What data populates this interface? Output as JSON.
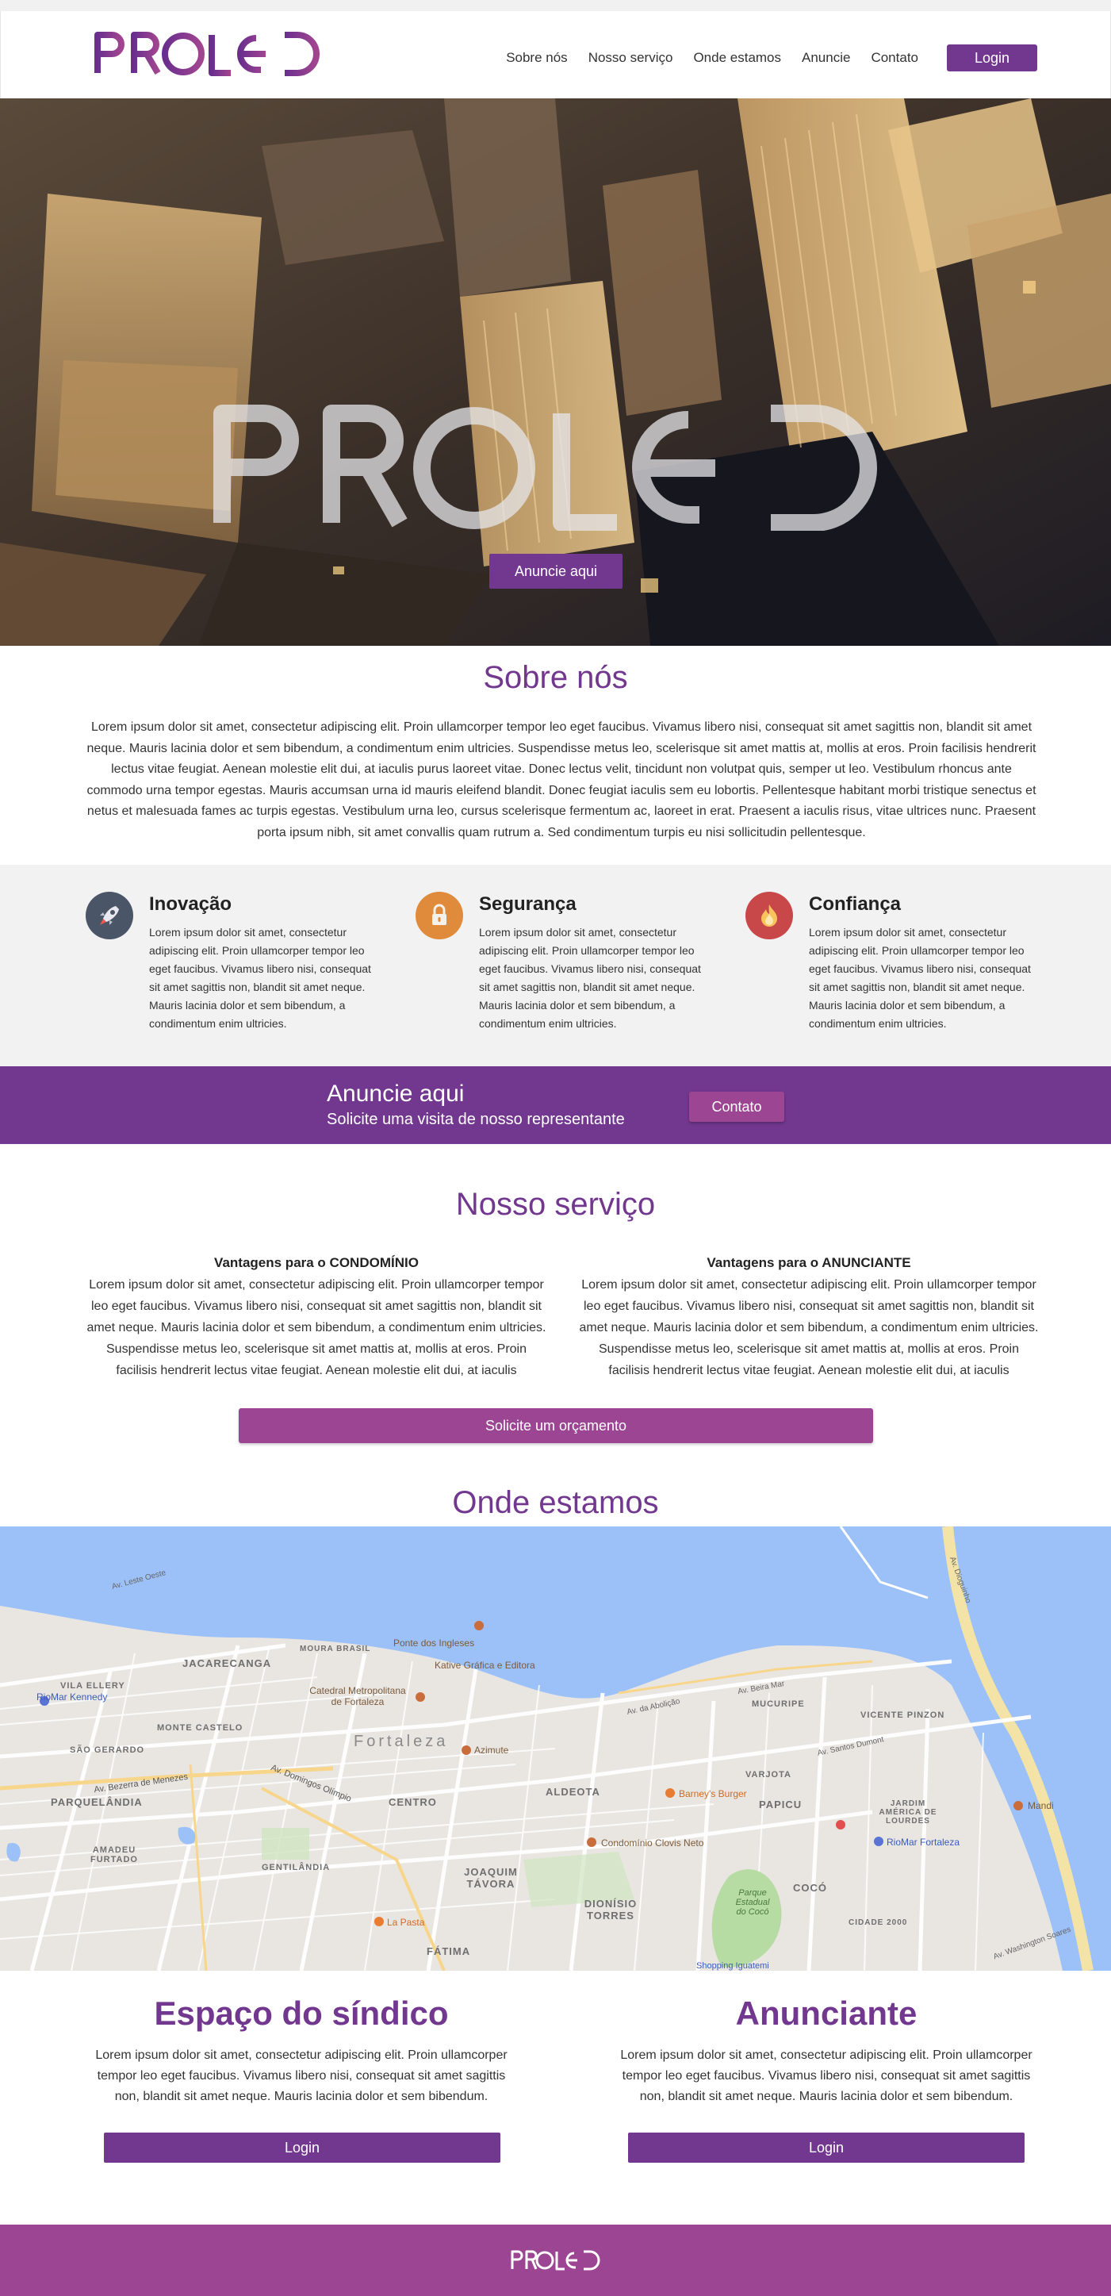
{
  "nav": {
    "brand": "PROLED",
    "links": [
      "Sobre nós",
      "Nosso serviço",
      "Onde estamos",
      "Anuncie",
      "Contato"
    ],
    "login": "Login"
  },
  "hero": {
    "button": "Anuncie aqui"
  },
  "about": {
    "title": "Sobre nós",
    "text": "Lorem ipsum dolor sit amet, consectetur adipiscing elit. Proin ullamcorper tempor leo eget faucibus. Vivamus libero nisi, consequat sit amet sagittis non, blandit sit amet neque. Mauris lacinia dolor et sem bibendum, a condimentum enim ultricies. Suspendisse metus leo, scelerisque sit amet mattis at, mollis at eros. Proin facilisis hendrerit lectus vitae feugiat. Aenean molestie elit dui, at iaculis purus laoreet vitae. Donec lectus velit, tincidunt non volutpat quis, semper ut leo. Vestibulum rhoncus ante commodo urna tempor egestas. Mauris accumsan urna id mauris eleifend blandit. Donec feugiat iaculis sem eu lobortis. Pellentesque habitant morbi tristique senectus et netus et malesuada fames ac turpis egestas. Vestibulum urna leo, cursus scelerisque fermentum ac, laoreet in erat. Praesent a iaculis risus, vitae ultrices nunc. Praesent porta ipsum nibh, sit amet convallis quam rutrum a. Sed condimentum turpis eu nisi sollicitudin pellentesque."
  },
  "features": [
    {
      "title": "Inovação",
      "icon": "rocket-icon",
      "color": "#4a5568",
      "text": "Lorem ipsum dolor sit amet, consectetur adipiscing elit. Proin ullamcorper tempor leo eget faucibus. Vivamus libero nisi, consequat sit amet sagittis non, blandit sit amet neque. Mauris lacinia dolor et sem bibendum, a condimentum enim ultricies."
    },
    {
      "title": "Segurança",
      "icon": "lock-icon",
      "color": "#e08a3c",
      "text": "Lorem ipsum dolor sit amet, consectetur adipiscing elit. Proin ullamcorper tempor leo eget faucibus. Vivamus libero nisi, consequat sit amet sagittis non, blandit sit amet neque. Mauris lacinia dolor et sem bibendum, a condimentum enim ultricies."
    },
    {
      "title": "Confiança",
      "icon": "flame-icon",
      "color": "#c8484a",
      "text": "Lorem ipsum dolor sit amet, consectetur adipiscing elit. Proin ullamcorper tempor leo eget faucibus. Vivamus libero nisi, consequat sit amet sagittis non, blandit sit amet neque. Mauris lacinia dolor et sem bibendum, a condimentum enim ultricies."
    }
  ],
  "cta": {
    "title": "Anuncie aqui",
    "subtitle": "Solicite uma visita de nosso representante",
    "button": "Contato"
  },
  "service": {
    "title": "Nosso serviço",
    "columns": [
      {
        "heading": "Vantagens para o CONDOMÍNIO",
        "text": "Lorem ipsum dolor sit amet, consectetur adipiscing elit. Proin ullamcorper tempor leo eget faucibus. Vivamus libero nisi, consequat sit amet sagittis non, blandit sit amet neque. Mauris lacinia dolor et sem bibendum, a condimentum enim ultricies. Suspendisse metus leo, scelerisque sit amet mattis at, mollis at eros. Proin facilisis hendrerit lectus vitae feugiat. Aenean molestie elit dui, at iaculis"
      },
      {
        "heading": "Vantagens para o ANUNCIANTE",
        "text": "Lorem ipsum dolor sit amet, consectetur adipiscing elit. Proin ullamcorper tempor leo eget faucibus. Vivamus libero nisi, consequat sit amet sagittis non, blandit sit amet neque. Mauris lacinia dolor et sem bibendum, a condimentum enim ultricies. Suspendisse metus leo, scelerisque sit amet mattis at, mollis at eros. Proin facilisis hendrerit lectus vitae feugiat. Aenean molestie elit dui, at iaculis"
      }
    ],
    "button": "Solicite um orçamento"
  },
  "location": {
    "title": "Onde estamos",
    "map_labels": {
      "fortaleza": "Fortaleza",
      "jacarecanga": "JACARECANGA",
      "vila_ellery": "VILA ELLERY",
      "riomar_kennedy": "RioMar Kennedy",
      "monte_castelo": "MONTE CASTELO",
      "sao_gerardo": "SÃO GERARDO",
      "parquelandia": "PARQUELÂNDIA",
      "amadeu_furtado": "AMADEU FURTADO",
      "gentilandia": "GENTILÂNDIA",
      "centro": "CENTRO",
      "joaquim_tavora": "JOAQUIM TÁVORA",
      "dionisio_torres": "DIONÍSIO TORRES",
      "aldeota": "ALDEOTA",
      "papicu": "PAPICU",
      "coco": "COCÓ",
      "varjota": "VARJOTA",
      "mucuripe": "MUCURIPE",
      "vicente_pinzon": "VICENTE PINZON",
      "jardim_america": "JARDIM AMÉRICA DE LOURDES",
      "cidade_2000": "CIDADE 2000",
      "fatima": "FÁTIMA",
      "moura_brasil": "MOURA BRASIL",
      "ponte_ingleses": "Ponte dos Ingleses",
      "kative": "Kative Gráfica e Editora",
      "catedral": "Catedral Metropolitana de Fortaleza",
      "azimute": "Azimute",
      "barneys": "Barney's Burger",
      "condominio": "Condomínio Clovis Neto",
      "la_pasta": "La Pasta",
      "riomar_fortaleza": "RioMar Fortaleza",
      "parque_coco": "Parque Estadual do Cocó",
      "shopping": "Shopping Iguatemi",
      "mandi": "Mandi",
      "av_leste_oeste": "Av. Leste Oeste",
      "av_bezerra": "Av. Bezerra de Menezes",
      "av_domingos": "Av. Domingos Olímpio",
      "av_abolicao": "Av. da Abolição",
      "av_beira_mar": "Av. Beira Mar",
      "av_santos_dumont": "Av. Santos Dumont",
      "av_dioguinho": "Av. Dioguinho",
      "av_washington": "Av. Washington Soares"
    }
  },
  "panels": [
    {
      "title": "Espaço do síndico",
      "text": "Lorem ipsum dolor sit amet, consectetur adipiscing elit. Proin ullamcorper tempor leo eget faucibus. Vivamus libero nisi, consequat sit amet sagittis non, blandit sit amet neque. Mauris lacinia dolor et sem bibendum.",
      "button": "Login"
    },
    {
      "title": "Anunciante",
      "text": "Lorem ipsum dolor sit amet, consectetur adipiscing elit. Proin ullamcorper tempor leo eget faucibus. Vivamus libero nisi, consequat sit amet sagittis non, blandit sit amet neque. Mauris lacinia dolor et sem bibendum.",
      "button": "Login"
    }
  ],
  "colors": {
    "brand": "#72378f",
    "accent": "#9c4593",
    "feature_bg": "#f2f2f2"
  }
}
